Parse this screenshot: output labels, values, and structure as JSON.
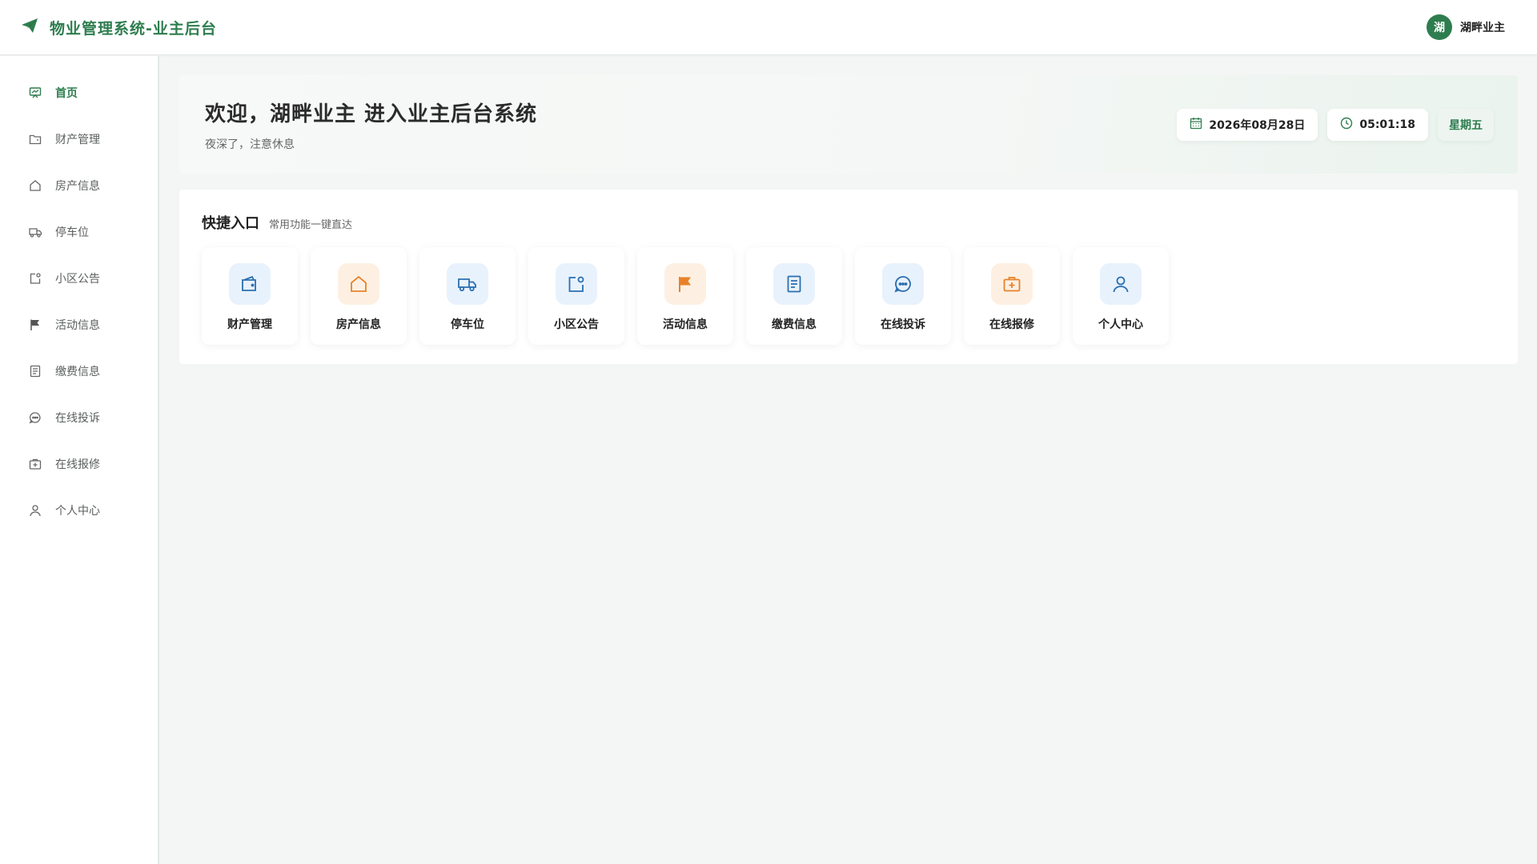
{
  "header": {
    "brand_title": "物业管理系统-业主后台",
    "user_avatar": "湖",
    "user_name": "湖畔业主"
  },
  "sidebar": {
    "items": [
      {
        "label": "首页",
        "icon": "home-board-icon",
        "active": true
      },
      {
        "label": "财产管理",
        "icon": "folder-icon"
      },
      {
        "label": "房产信息",
        "icon": "house-icon"
      },
      {
        "label": "停车位",
        "icon": "truck-icon"
      },
      {
        "label": "小区公告",
        "icon": "notice-icon"
      },
      {
        "label": "活动信息",
        "icon": "flag-icon"
      },
      {
        "label": "缴费信息",
        "icon": "document-icon"
      },
      {
        "label": "在线投诉",
        "icon": "chat-icon"
      },
      {
        "label": "在线报修",
        "icon": "repair-kit-icon"
      },
      {
        "label": "个人中心",
        "icon": "user-icon"
      }
    ]
  },
  "banner": {
    "title": "欢迎，湖畔业主 进入业主后台系统",
    "subtitle": "夜深了，注意休息",
    "date": "2026年08月28日",
    "time": "05:01:18",
    "weekday": "星期五"
  },
  "quick": {
    "title": "快捷入口",
    "subtitle": "常用功能一键直达",
    "cards": [
      {
        "label": "财产管理",
        "icon": "wallet-icon"
      },
      {
        "label": "房产信息",
        "icon": "house-icon"
      },
      {
        "label": "停车位",
        "icon": "truck-icon"
      },
      {
        "label": "小区公告",
        "icon": "notice-icon"
      },
      {
        "label": "活动信息",
        "icon": "flag-icon"
      },
      {
        "label": "缴费信息",
        "icon": "document-icon"
      },
      {
        "label": "在线投诉",
        "icon": "chat-icon"
      },
      {
        "label": "在线报修",
        "icon": "repair-kit-icon"
      },
      {
        "label": "个人中心",
        "icon": "user-icon"
      }
    ]
  },
  "colors": {
    "brand_green": "#2e7d4f",
    "icon_blue": "#2a6fb0",
    "icon_orange": "#e8822a"
  }
}
